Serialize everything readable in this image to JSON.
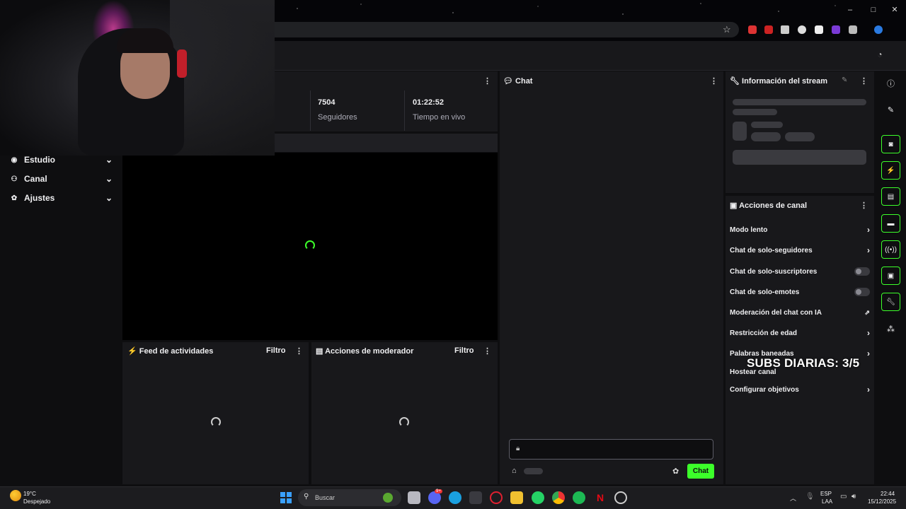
{
  "sidebar": {
    "items": [
      {
        "label": "Estudio",
        "icon": "studio-icon"
      },
      {
        "label": "Canal",
        "icon": "channel-icon"
      },
      {
        "label": "Ajustes",
        "icon": "gear-icon"
      }
    ]
  },
  "stats": [
    {
      "value": "7504",
      "label": "Seguidores"
    },
    {
      "value": "01:22:52",
      "label": "Tiempo en vivo"
    }
  ],
  "activity_feed": {
    "title": "Feed de actividades",
    "filter": "Filtro"
  },
  "mod_actions": {
    "title": "Acciones de moderador",
    "filter": "Filtro"
  },
  "chat": {
    "title": "Chat",
    "send_label": "Chat"
  },
  "stream_info": {
    "title": "Información del stream"
  },
  "channel_actions": {
    "title": "Acciones de canal",
    "items": [
      {
        "label": "Modo lento",
        "control": "chevron"
      },
      {
        "label": "Chat de solo-seguidores",
        "control": "chevron"
      },
      {
        "label": "Chat de solo-suscriptores",
        "control": "toggle"
      },
      {
        "label": "Chat de solo-emotes",
        "control": "toggle"
      },
      {
        "label": "Moderación del chat con IA",
        "control": "external"
      },
      {
        "label": "Restricción de edad",
        "control": "chevron"
      },
      {
        "label": "Palabras baneadas",
        "control": "chevron"
      },
      {
        "label": "Hostear canal",
        "control": "none"
      },
      {
        "label": "Configurar objetivos",
        "control": "chevron"
      }
    ]
  },
  "overlay": {
    "text": "SUBS DIARIAS: 3/5"
  },
  "colors": {
    "accent": "#3cff2a",
    "panel": "#18181b",
    "background": "#0e0e10"
  },
  "taskbar": {
    "weather_temp": "19°C",
    "weather_desc": "Despejado",
    "search_placeholder": "Buscar",
    "language": "ESP",
    "layout": "LAA",
    "time": "22:44",
    "date": "15/12/2025",
    "discord_badge": "9+"
  }
}
